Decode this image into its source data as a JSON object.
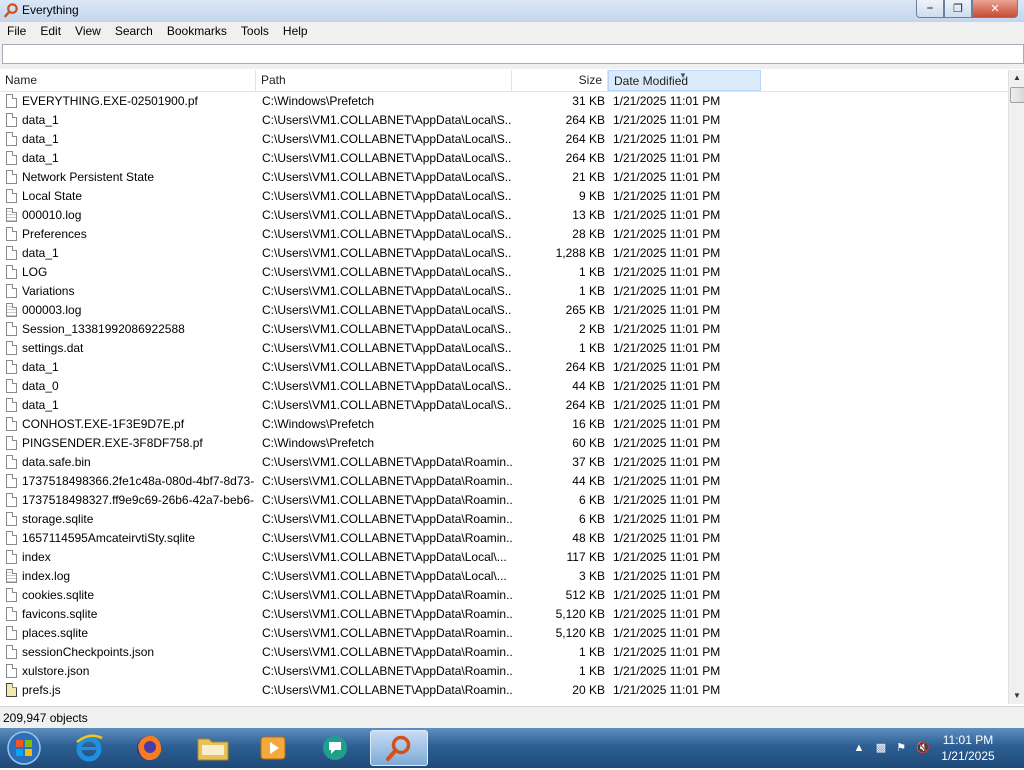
{
  "window": {
    "title": "Everything"
  },
  "menu": [
    "File",
    "Edit",
    "View",
    "Search",
    "Bookmarks",
    "Tools",
    "Help"
  ],
  "search": {
    "value": "",
    "placeholder": ""
  },
  "columns": {
    "name": "Name",
    "path": "Path",
    "size": "Size",
    "date": "Date Modified",
    "sorted_by": "Date Modified"
  },
  "rows": [
    {
      "icon": "file",
      "name": "EVERYTHING.EXE-02501900.pf",
      "path": "C:\\Windows\\Prefetch",
      "size": "31 KB",
      "date": "1/21/2025 11:01 PM"
    },
    {
      "icon": "file",
      "name": "data_1",
      "path": "C:\\Users\\VM1.COLLABNET\\AppData\\Local\\S...",
      "size": "264 KB",
      "date": "1/21/2025 11:01 PM"
    },
    {
      "icon": "file",
      "name": "data_1",
      "path": "C:\\Users\\VM1.COLLABNET\\AppData\\Local\\S...",
      "size": "264 KB",
      "date": "1/21/2025 11:01 PM"
    },
    {
      "icon": "file",
      "name": "data_1",
      "path": "C:\\Users\\VM1.COLLABNET\\AppData\\Local\\S...",
      "size": "264 KB",
      "date": "1/21/2025 11:01 PM"
    },
    {
      "icon": "file",
      "name": "Network Persistent State",
      "path": "C:\\Users\\VM1.COLLABNET\\AppData\\Local\\S...",
      "size": "21 KB",
      "date": "1/21/2025 11:01 PM"
    },
    {
      "icon": "file",
      "name": "Local State",
      "path": "C:\\Users\\VM1.COLLABNET\\AppData\\Local\\S...",
      "size": "9 KB",
      "date": "1/21/2025 11:01 PM"
    },
    {
      "icon": "text",
      "name": "000010.log",
      "path": "C:\\Users\\VM1.COLLABNET\\AppData\\Local\\S...",
      "size": "13 KB",
      "date": "1/21/2025 11:01 PM"
    },
    {
      "icon": "file",
      "name": "Preferences",
      "path": "C:\\Users\\VM1.COLLABNET\\AppData\\Local\\S...",
      "size": "28 KB",
      "date": "1/21/2025 11:01 PM"
    },
    {
      "icon": "file",
      "name": "data_1",
      "path": "C:\\Users\\VM1.COLLABNET\\AppData\\Local\\S...",
      "size": "1,288 KB",
      "date": "1/21/2025 11:01 PM"
    },
    {
      "icon": "file",
      "name": "LOG",
      "path": "C:\\Users\\VM1.COLLABNET\\AppData\\Local\\S...",
      "size": "1 KB",
      "date": "1/21/2025 11:01 PM"
    },
    {
      "icon": "file",
      "name": "Variations",
      "path": "C:\\Users\\VM1.COLLABNET\\AppData\\Local\\S...",
      "size": "1 KB",
      "date": "1/21/2025 11:01 PM"
    },
    {
      "icon": "text",
      "name": "000003.log",
      "path": "C:\\Users\\VM1.COLLABNET\\AppData\\Local\\S...",
      "size": "265 KB",
      "date": "1/21/2025 11:01 PM"
    },
    {
      "icon": "file",
      "name": "Session_13381992086922588",
      "path": "C:\\Users\\VM1.COLLABNET\\AppData\\Local\\S...",
      "size": "2 KB",
      "date": "1/21/2025 11:01 PM"
    },
    {
      "icon": "file",
      "name": "settings.dat",
      "path": "C:\\Users\\VM1.COLLABNET\\AppData\\Local\\S...",
      "size": "1 KB",
      "date": "1/21/2025 11:01 PM"
    },
    {
      "icon": "file",
      "name": "data_1",
      "path": "C:\\Users\\VM1.COLLABNET\\AppData\\Local\\S...",
      "size": "264 KB",
      "date": "1/21/2025 11:01 PM"
    },
    {
      "icon": "file",
      "name": "data_0",
      "path": "C:\\Users\\VM1.COLLABNET\\AppData\\Local\\S...",
      "size": "44 KB",
      "date": "1/21/2025 11:01 PM"
    },
    {
      "icon": "file",
      "name": "data_1",
      "path": "C:\\Users\\VM1.COLLABNET\\AppData\\Local\\S...",
      "size": "264 KB",
      "date": "1/21/2025 11:01 PM"
    },
    {
      "icon": "file",
      "name": "CONHOST.EXE-1F3E9D7E.pf",
      "path": "C:\\Windows\\Prefetch",
      "size": "16 KB",
      "date": "1/21/2025 11:01 PM"
    },
    {
      "icon": "file",
      "name": "PINGSENDER.EXE-3F8DF758.pf",
      "path": "C:\\Windows\\Prefetch",
      "size": "60 KB",
      "date": "1/21/2025 11:01 PM"
    },
    {
      "icon": "file",
      "name": "data.safe.bin",
      "path": "C:\\Users\\VM1.COLLABNET\\AppData\\Roamin...",
      "size": "37 KB",
      "date": "1/21/2025 11:01 PM"
    },
    {
      "icon": "file",
      "name": "1737518498366.2fe1c48a-080d-4bf7-8d73-...",
      "path": "C:\\Users\\VM1.COLLABNET\\AppData\\Roamin...",
      "size": "44 KB",
      "date": "1/21/2025 11:01 PM"
    },
    {
      "icon": "file",
      "name": "1737518498327.ff9e9c69-26b6-42a7-beb6-...",
      "path": "C:\\Users\\VM1.COLLABNET\\AppData\\Roamin...",
      "size": "6 KB",
      "date": "1/21/2025 11:01 PM"
    },
    {
      "icon": "file",
      "name": "storage.sqlite",
      "path": "C:\\Users\\VM1.COLLABNET\\AppData\\Roamin...",
      "size": "6 KB",
      "date": "1/21/2025 11:01 PM"
    },
    {
      "icon": "file",
      "name": "1657114595AmcateirvtiSty.sqlite",
      "path": "C:\\Users\\VM1.COLLABNET\\AppData\\Roamin...",
      "size": "48 KB",
      "date": "1/21/2025 11:01 PM"
    },
    {
      "icon": "file",
      "name": "index",
      "path": "C:\\Users\\VM1.COLLABNET\\AppData\\Local\\...",
      "size": "117 KB",
      "date": "1/21/2025 11:01 PM"
    },
    {
      "icon": "text",
      "name": "index.log",
      "path": "C:\\Users\\VM1.COLLABNET\\AppData\\Local\\...",
      "size": "3 KB",
      "date": "1/21/2025 11:01 PM"
    },
    {
      "icon": "file",
      "name": "cookies.sqlite",
      "path": "C:\\Users\\VM1.COLLABNET\\AppData\\Roamin...",
      "size": "512 KB",
      "date": "1/21/2025 11:01 PM"
    },
    {
      "icon": "file",
      "name": "favicons.sqlite",
      "path": "C:\\Users\\VM1.COLLABNET\\AppData\\Roamin...",
      "size": "5,120 KB",
      "date": "1/21/2025 11:01 PM"
    },
    {
      "icon": "file",
      "name": "places.sqlite",
      "path": "C:\\Users\\VM1.COLLABNET\\AppData\\Roamin...",
      "size": "5,120 KB",
      "date": "1/21/2025 11:01 PM"
    },
    {
      "icon": "file",
      "name": "sessionCheckpoints.json",
      "path": "C:\\Users\\VM1.COLLABNET\\AppData\\Roamin...",
      "size": "1 KB",
      "date": "1/21/2025 11:01 PM"
    },
    {
      "icon": "file",
      "name": "xulstore.json",
      "path": "C:\\Users\\VM1.COLLABNET\\AppData\\Roamin...",
      "size": "1 KB",
      "date": "1/21/2025 11:01 PM"
    },
    {
      "icon": "script",
      "name": "prefs.js",
      "path": "C:\\Users\\VM1.COLLABNET\\AppData\\Roamin...",
      "size": "20 KB",
      "date": "1/21/2025 11:01 PM"
    }
  ],
  "status": {
    "objects": "209,947 objects"
  },
  "taskbar": {
    "apps": [
      "start-orb-icon",
      "internet-explorer-icon",
      "firefox-icon",
      "file-explorer-icon",
      "media-player-icon",
      "network-app-icon",
      "everything-search-icon"
    ],
    "clock_time": "11:01 PM",
    "clock_date": "1/21/2025"
  },
  "colors": {
    "titlebar": "#c3d6ee",
    "taskbar": "#2d5f94",
    "sorted_header": "#dcebfc"
  }
}
